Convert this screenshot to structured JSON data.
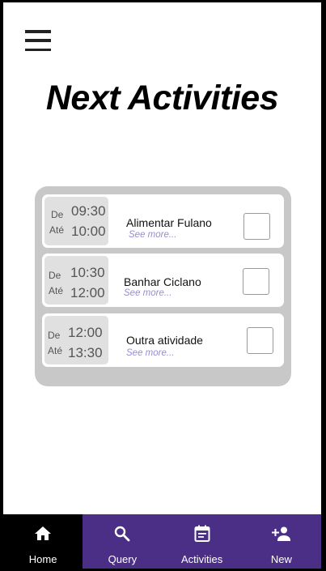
{
  "header": {
    "menu_icon": "hamburger-menu-icon"
  },
  "page": {
    "title": "Next Activities"
  },
  "activities": [
    {
      "from_label": "De",
      "to_label": "Até",
      "start": "09:30",
      "end": "10:00",
      "title": "Alimentar Fulano",
      "see_more": "See more...",
      "checked": false
    },
    {
      "from_label": "De",
      "to_label": "Até",
      "start": "10:30",
      "end": "12:00",
      "title": "Banhar Ciclano",
      "see_more": "See more...",
      "checked": false
    },
    {
      "from_label": "De",
      "to_label": "Até",
      "start": "12:00",
      "end": "13:30",
      "title": "Outra atividade",
      "see_more": "See more...",
      "checked": false
    }
  ],
  "nav": {
    "items": [
      {
        "label": "Home",
        "icon": "home-icon",
        "active": true
      },
      {
        "label": "Query",
        "icon": "search-icon",
        "active": false
      },
      {
        "label": "Activities",
        "icon": "calendar-icon",
        "active": false
      },
      {
        "label": "New",
        "icon": "add-person-icon",
        "active": false
      }
    ]
  },
  "colors": {
    "nav_background": "#4b2f86",
    "nav_active": "#000000",
    "see_more": "#9b8ad6",
    "panel": "#c8c8c8",
    "time_box": "#e0e0e0"
  }
}
